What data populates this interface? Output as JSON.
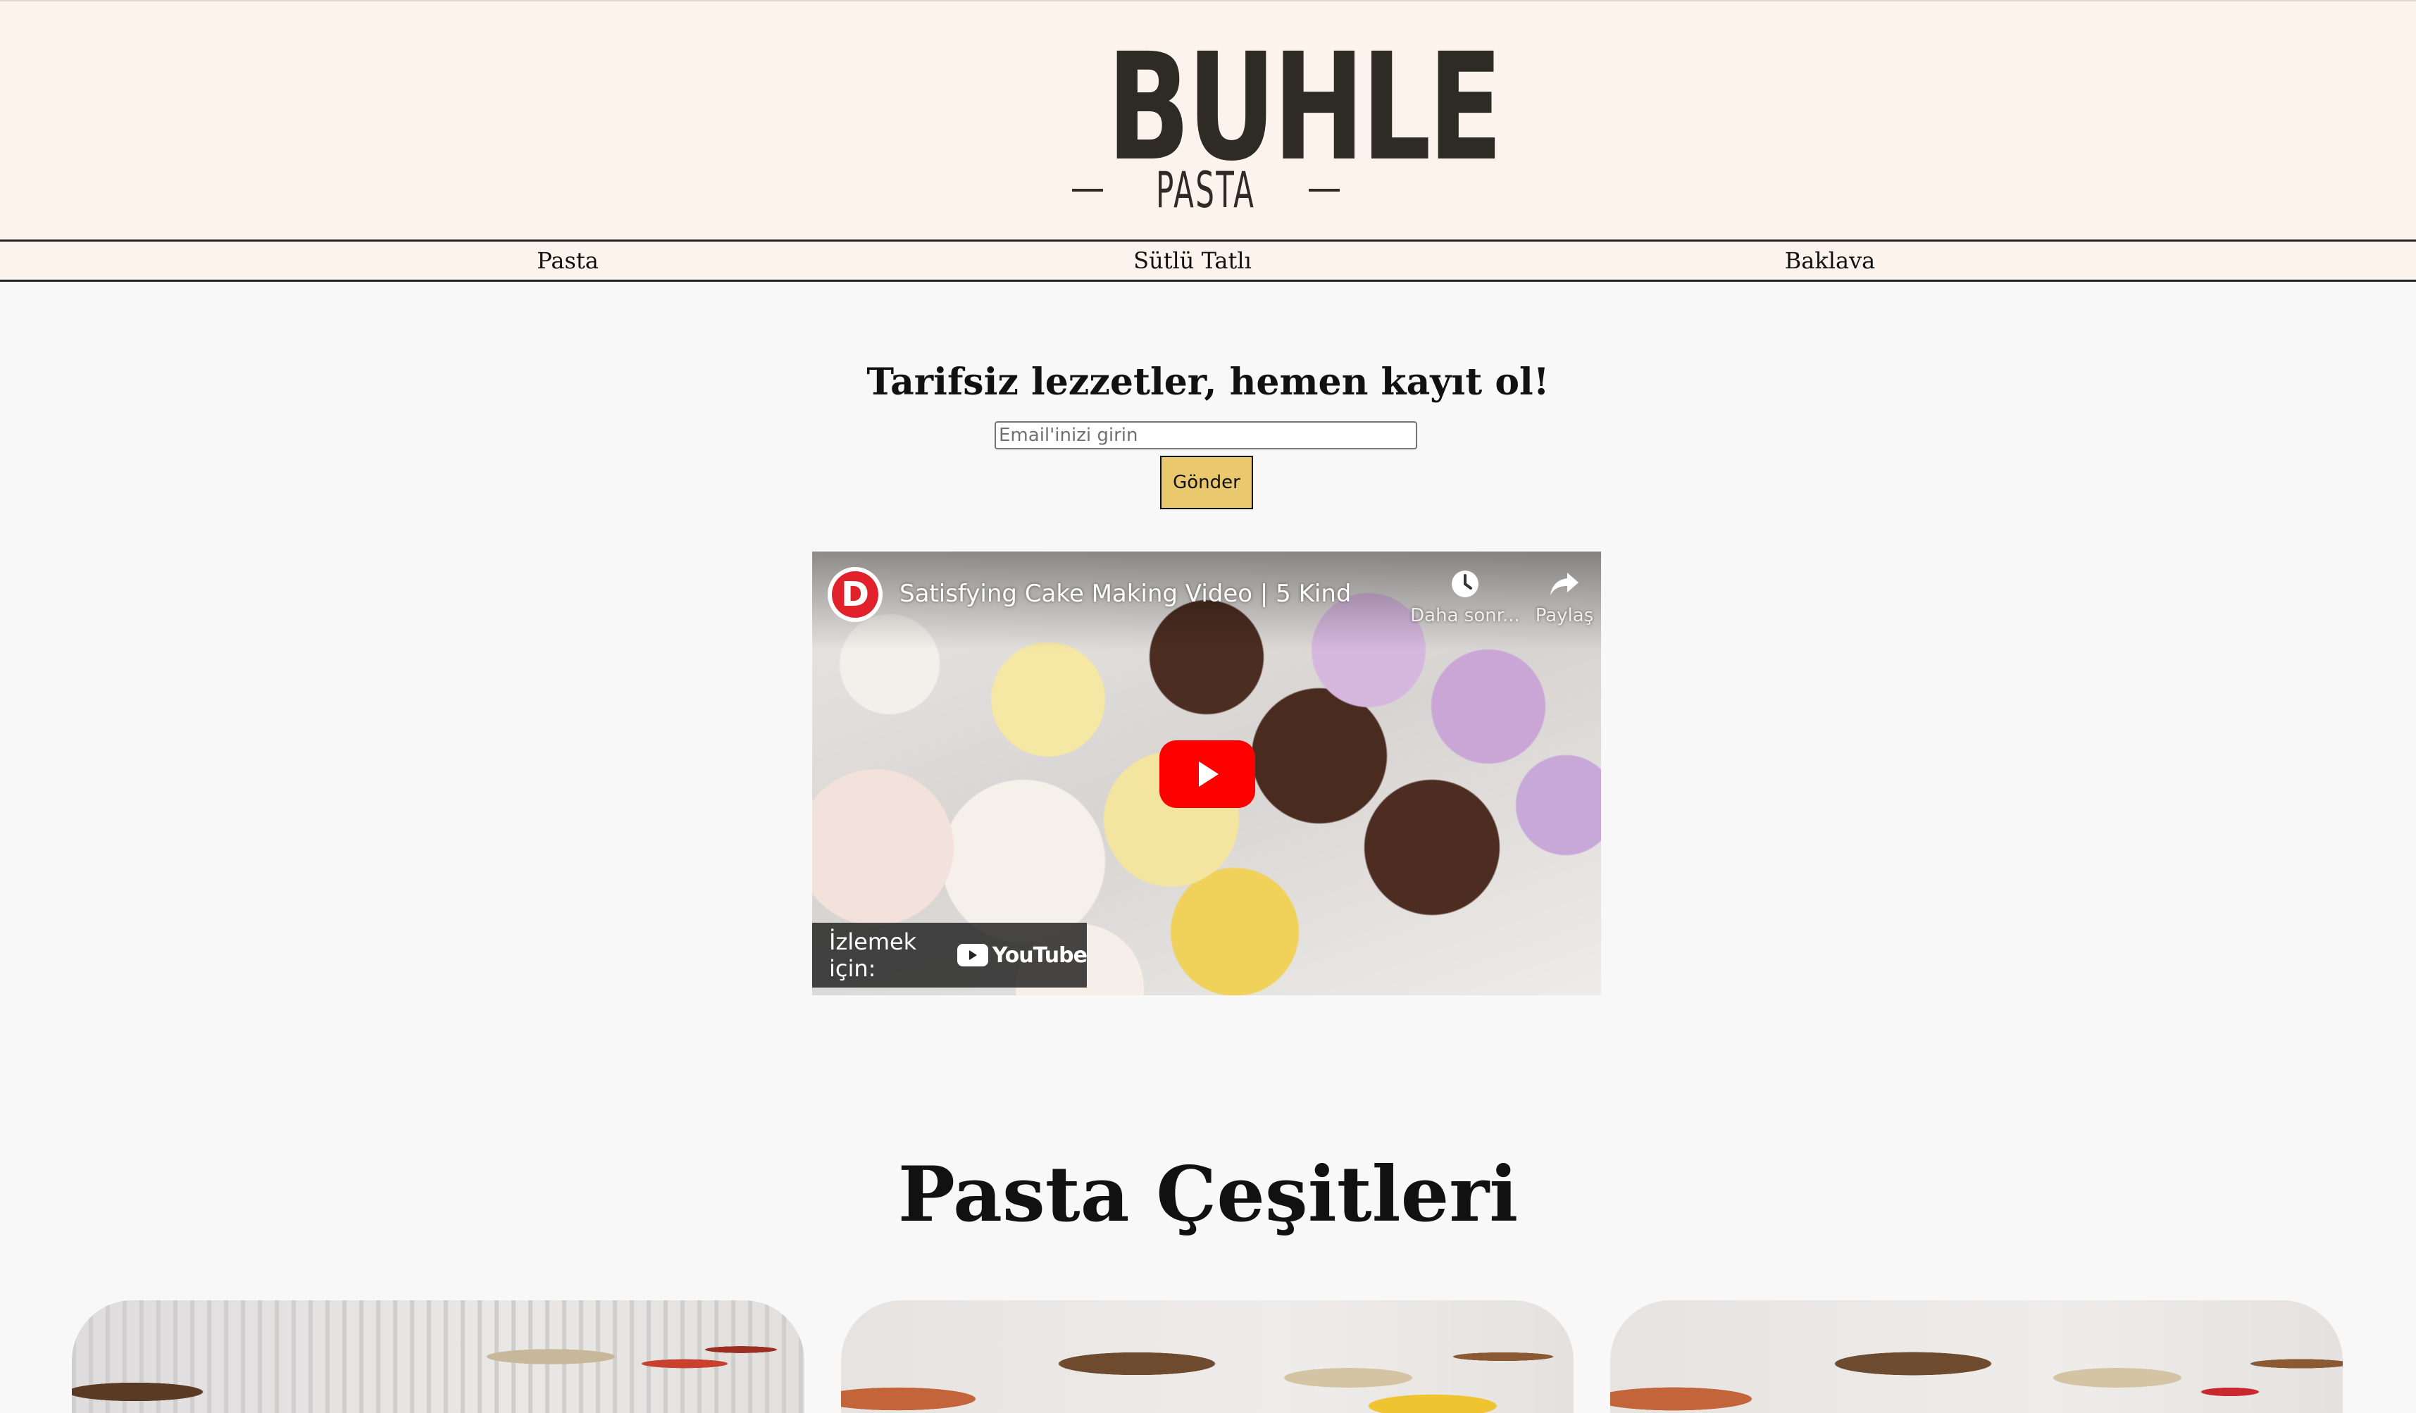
{
  "brand": {
    "name": "BUHLE",
    "subtitle": "PASTA"
  },
  "nav": {
    "items": [
      {
        "label": "Pasta"
      },
      {
        "label": "Sütlü Tatlı"
      },
      {
        "label": "Baklava"
      }
    ]
  },
  "signup": {
    "title": "Tarifsiz lezzetler, hemen kayıt ol!",
    "email_placeholder": "Email'inizi girin",
    "submit_label": "Gönder"
  },
  "video": {
    "channel_initial": "D",
    "title": "Satisfying Cake Making Video | 5 Kind...",
    "watch_later_label": "Daha sonr...",
    "share_label": "Paylaş",
    "watch_on_label": "İzlemek için:",
    "platform_label": "YouTube",
    "colors": {
      "play": "#ff0000",
      "channel": "#e1222a"
    }
  },
  "products_section": {
    "title": "Pasta Çeşitleri"
  },
  "colors": {
    "header_bg": "#fcf4ec",
    "button_bg": "#e9c86e",
    "page_bg": "#f8f8f8"
  }
}
